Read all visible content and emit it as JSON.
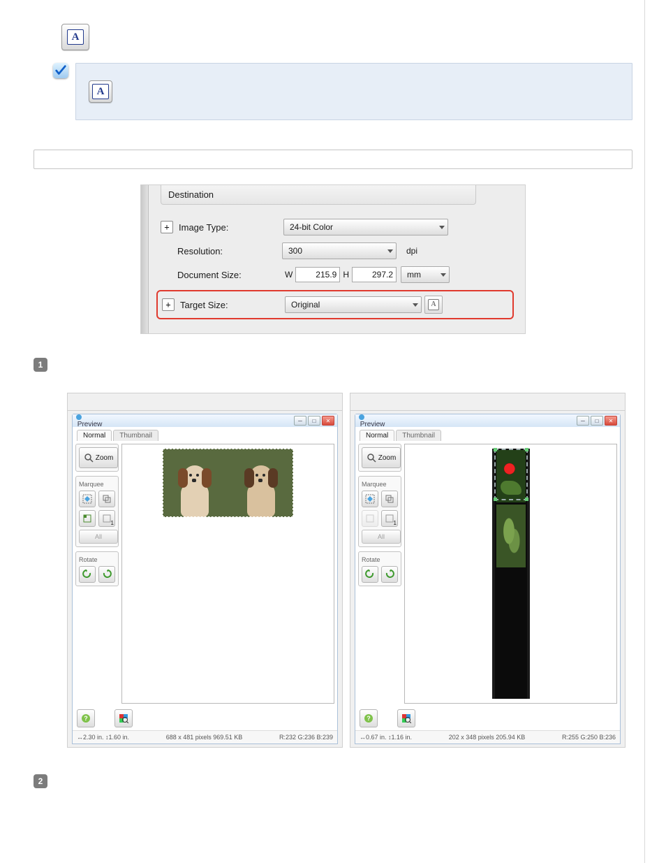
{
  "dest": {
    "group_title": "Destination",
    "image_type_label": "Image Type:",
    "image_type_value": "24-bit Color",
    "resolution_label": "Resolution:",
    "resolution_value": "300",
    "resolution_unit": "dpi",
    "docsize_label": "Document Size:",
    "docsize_w_label": "W",
    "docsize_w": "215.9",
    "docsize_h_label": "H",
    "docsize_h": "297.2",
    "docsize_unit": "mm",
    "target_label": "Target Size:",
    "target_value": "Original"
  },
  "steps": {
    "one": "1",
    "two": "2"
  },
  "preview": {
    "title": "Preview",
    "tab_normal": "Normal",
    "tab_thumb": "Thumbnail",
    "zoom": "Zoom",
    "marquee": "Marquee",
    "all": "All",
    "rotate": "Rotate",
    "dims_sub": "1"
  },
  "left_status": {
    "wh": "↔2.30 in. ↕1.60 in.",
    "px": "688 x 481 pixels 969.51 KB",
    "rgb": "R:232 G:236 B:239"
  },
  "right_status": {
    "wh": "↔0.67 in. ↕1.16 in.",
    "px": "202 x 348 pixels 205.94 KB",
    "rgb": "R:255 G:250 B:236"
  },
  "glyph": {
    "A": "A",
    "plus": "+",
    "min": "─",
    "max": "□",
    "x": "✕"
  }
}
